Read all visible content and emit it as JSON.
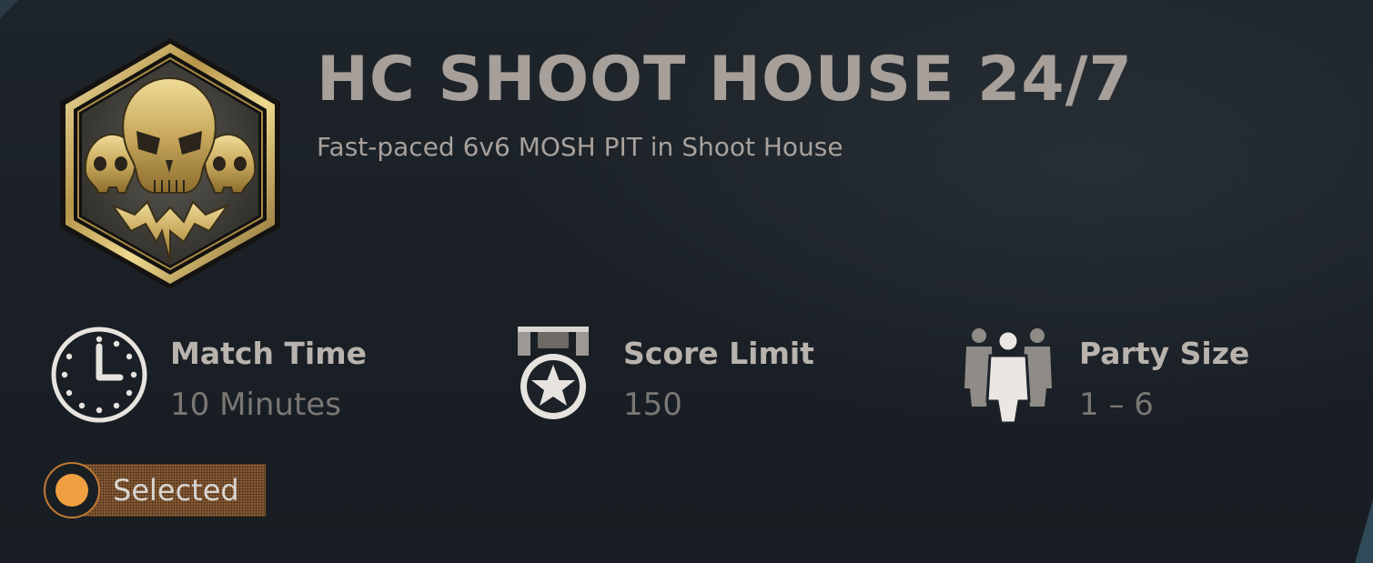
{
  "mode": {
    "title": "HC SHOOT HOUSE 24/7",
    "description": "Fast-paced 6v6 MOSH PIT in Shoot House",
    "emblem_icon": "skulls-emblem-icon"
  },
  "stats": [
    {
      "icon": "clock-icon",
      "label": "Match Time",
      "value": "10 Minutes"
    },
    {
      "icon": "star-medal-icon",
      "label": "Score Limit",
      "value": "150"
    },
    {
      "icon": "party-icon",
      "label": "Party Size",
      "value": "1 – 6"
    }
  ],
  "selection": {
    "label": "Selected",
    "accent": "#f0a040"
  },
  "colors": {
    "background": "#1a2026",
    "title": "#a79f99",
    "label": "#b9b3ae",
    "value": "#7a7774",
    "gold": "#c9ad62"
  }
}
